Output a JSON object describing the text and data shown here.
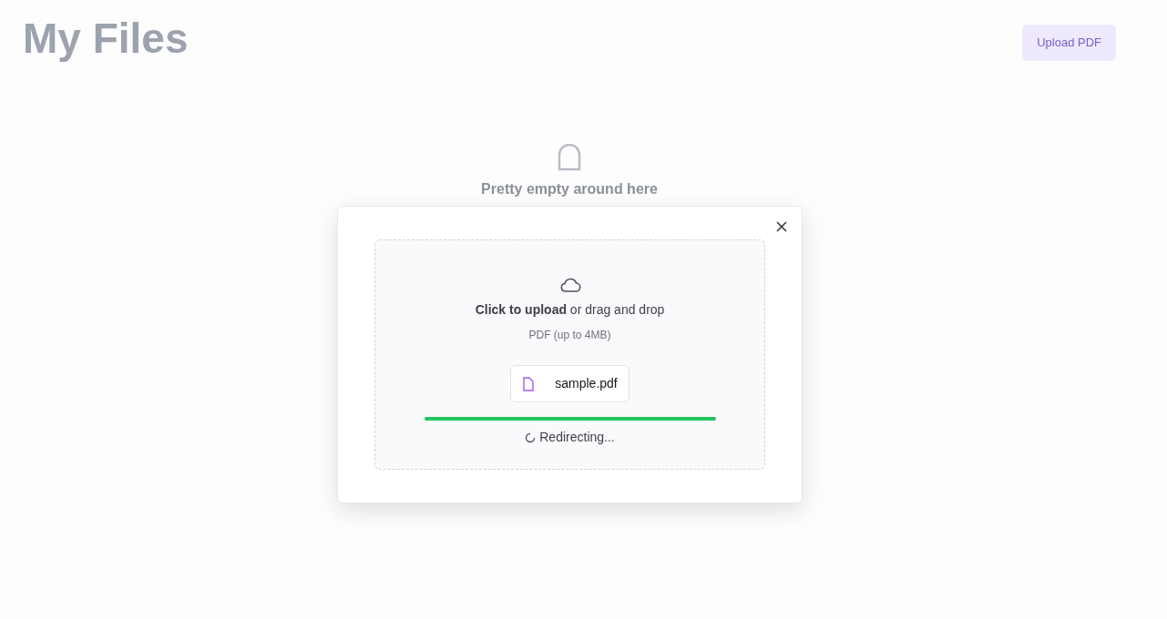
{
  "page": {
    "title": "My Files",
    "upload_button": "Upload PDF",
    "empty_message": "Pretty empty around here"
  },
  "dialog": {
    "prompt": "**Click to upload** or drag and drop",
    "hint": "PDF (up to 4MB)",
    "file": {
      "name": "sample.pdf"
    },
    "progress": {
      "level": 1.0
    },
    "status": "Redirecting..."
  }
}
